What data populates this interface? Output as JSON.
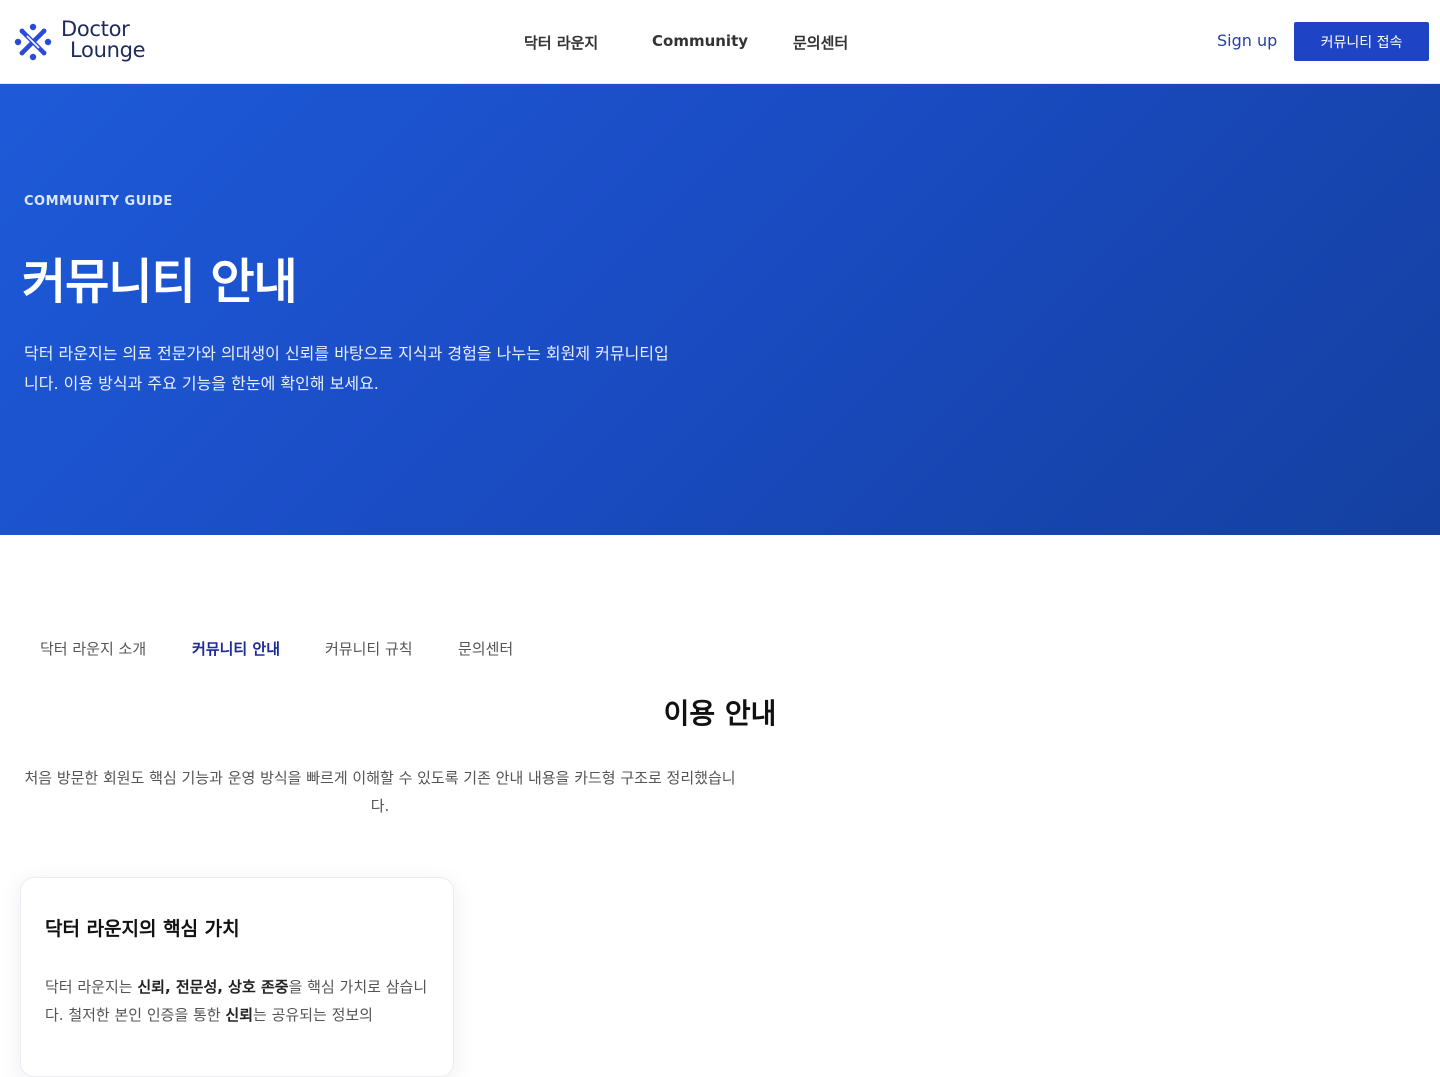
{
  "header": {
    "logo": {
      "line1": "Doctor",
      "line2": "Lounge",
      "icon": "logo-cross-icon"
    },
    "nav": [
      {
        "label": "닥터 라운지"
      },
      {
        "label": "Community"
      },
      {
        "label": "문의센터"
      }
    ],
    "signup_label": "Sign up",
    "cta_label": "커뮤니티 접속"
  },
  "hero": {
    "kicker": "COMMUNITY GUIDE",
    "title": "커뮤니티 안내",
    "description": "닥터 라운지는 의료 전문가와 의대생이 신뢰를 바탕으로 지식과 경험을 나누는 회원제 커뮤니티입니다. 이용 방식과 주요 기능을 한눈에 확인해 보세요."
  },
  "tabs": [
    {
      "label": "닥터 라운지 소개",
      "active": false
    },
    {
      "label": "커뮤니티 안내",
      "active": true
    },
    {
      "label": "커뮤니티 규칙",
      "active": false
    },
    {
      "label": "문의센터",
      "active": false
    }
  ],
  "section": {
    "title": "이용 안내",
    "description": "처음 방문한 회원도 핵심 기능과 운영 방식을 빠르게 이해할 수 있도록 기존 안내 내용을 카드형 구조로 정리했습니다."
  },
  "card": {
    "title": "닥터 라운지의 핵심 가치",
    "body": {
      "t1": "닥터 라운지는 ",
      "b1": "신뢰, 전문성, 상호 존중",
      "t2": "을 핵심 가치로 삼습니다. 철저한 본인 인증을 통한 ",
      "b2": "신뢰",
      "t3": "는 공유되는 정보의"
    }
  },
  "colors": {
    "primary": "#1f43c5",
    "hero_gradient_start": "#1e5ad8",
    "hero_gradient_end": "#1440a0",
    "logo_blue": "#2a4bd7",
    "active_tab": "#1b2a9c"
  }
}
